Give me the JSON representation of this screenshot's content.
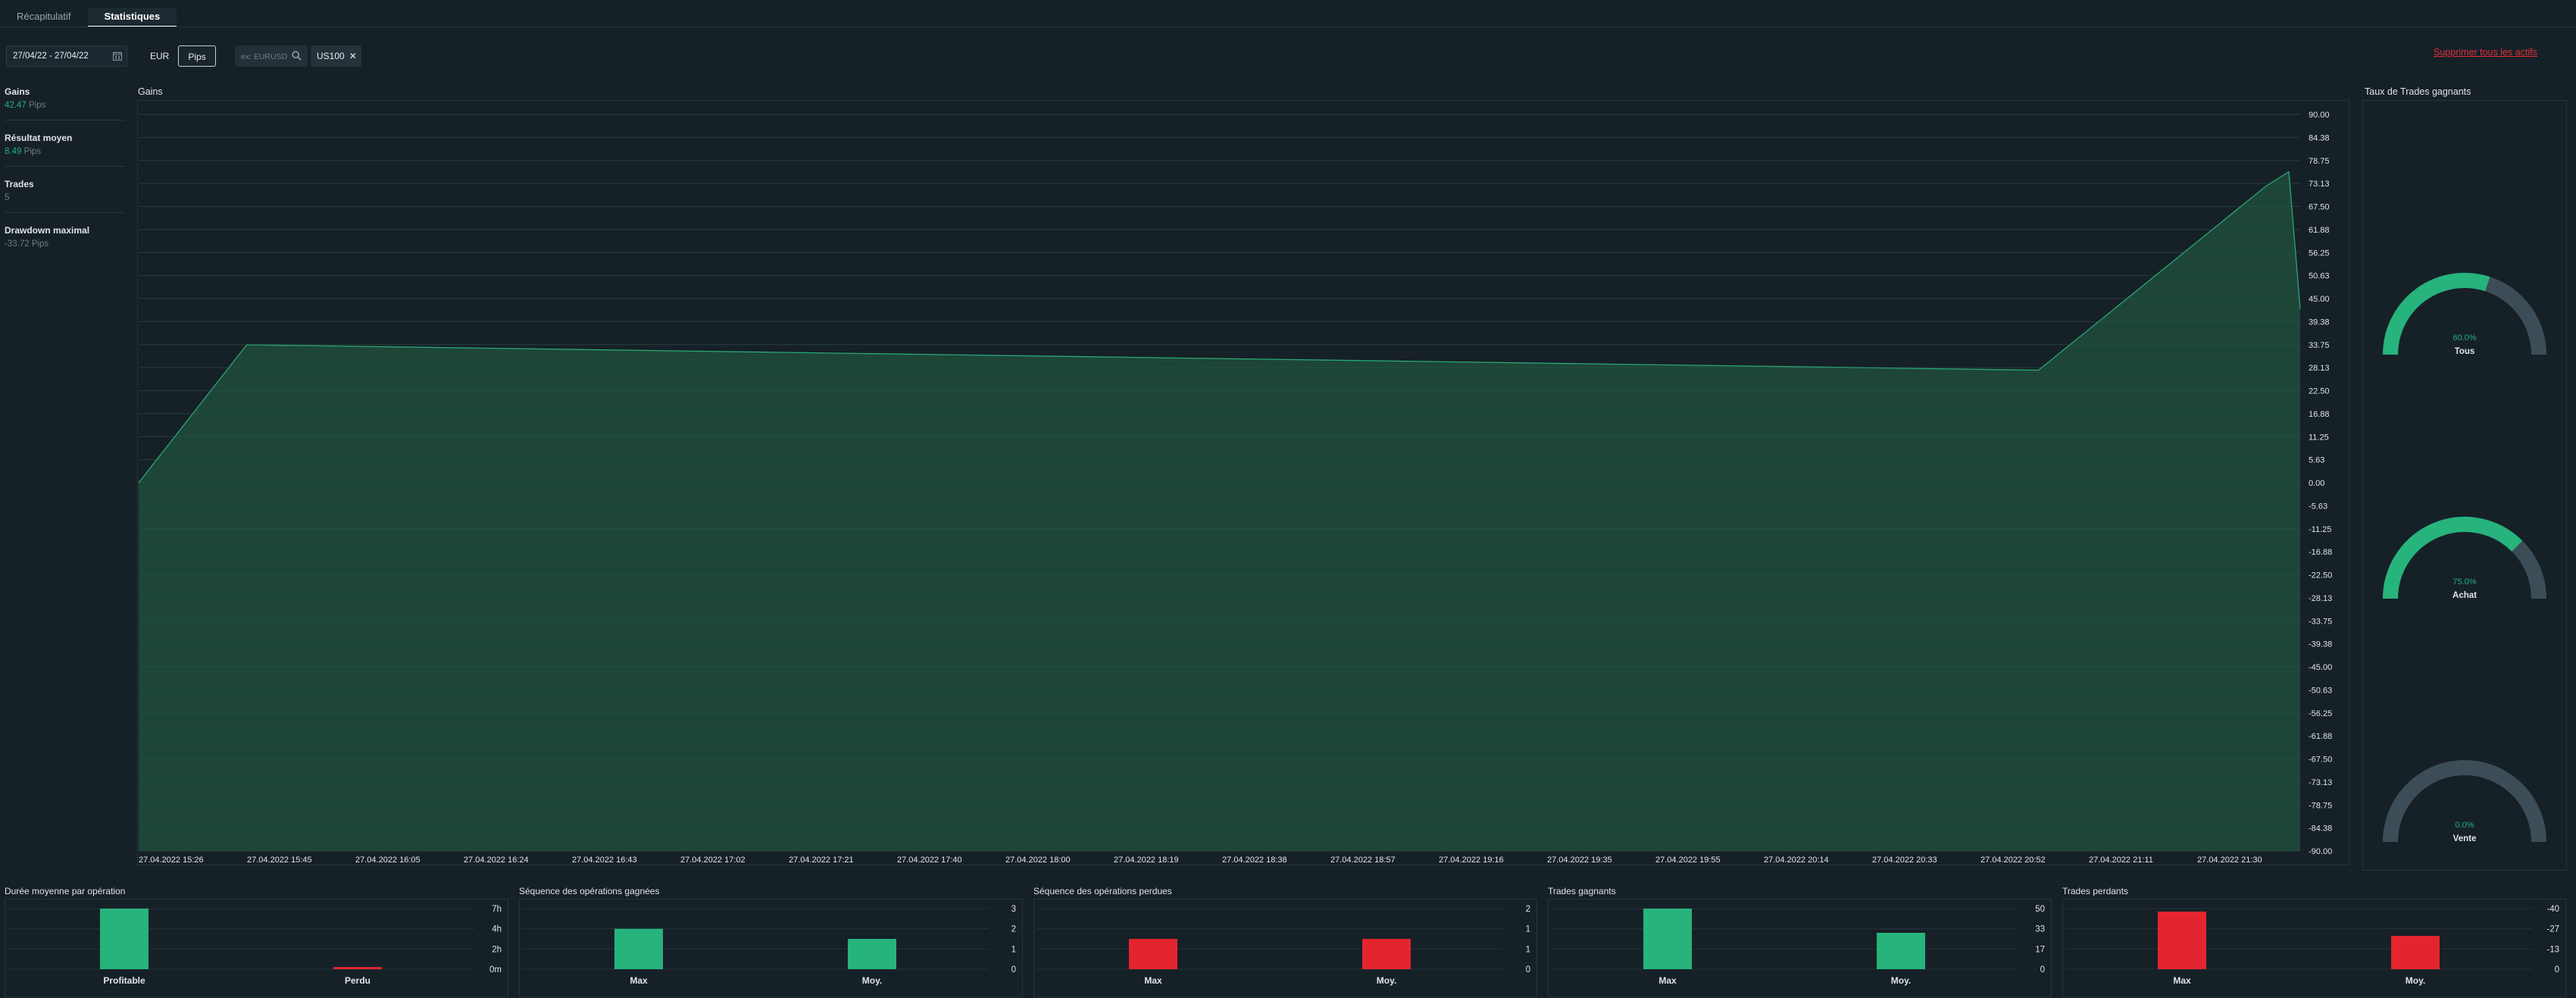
{
  "tabs": [
    {
      "label": "Récapitulatif",
      "active": false
    },
    {
      "label": "Statistiques",
      "active": true
    }
  ],
  "filters": {
    "date_range": "27/04/22 - 27/04/22",
    "currency_options": [
      "EUR",
      "Pips"
    ],
    "currency_selected": "Pips",
    "search_placeholder": "ex: EURUSD",
    "selected_asset": "US100",
    "remove_all_label": "Supprimer tous les actifs"
  },
  "stats": [
    {
      "label": "Gains",
      "value": "42.47",
      "unit": "Pips",
      "tone": "pos"
    },
    {
      "label": "Résultat moyen",
      "value": "8.49",
      "unit": "Pips",
      "tone": "pos"
    },
    {
      "label": "Trades",
      "value": "5",
      "unit": "",
      "tone": "neu"
    },
    {
      "label": "Drawdown maximal",
      "value": "-33.72",
      "unit": "Pips",
      "tone": "neu"
    }
  ],
  "colors": {
    "green": "#26b47c",
    "red": "#e42530",
    "gauge_track": "#3c4d57"
  },
  "main_chart": {
    "title": "Gains",
    "chart_data": {
      "type": "area",
      "title": "Gains",
      "ylim": [
        -90,
        90
      ],
      "y_ticks": [
        "90.00",
        "84.38",
        "78.75",
        "73.13",
        "67.50",
        "61.88",
        "56.25",
        "50.63",
        "45.00",
        "39.38",
        "33.75",
        "28.13",
        "22.50",
        "16.88",
        "11.25",
        "5.63",
        "0.00",
        "-5.63",
        "-11.25",
        "-16.88",
        "-22.50",
        "-28.13",
        "-33.75",
        "-39.38",
        "-45.00",
        "-50.63",
        "-56.25",
        "-61.88",
        "-67.50",
        "-73.13",
        "-78.75",
        "-84.38",
        "-90.00"
      ],
      "x_ticks": [
        "27.04.2022 15:26",
        "27.04.2022 15:45",
        "27.04.2022 16:05",
        "27.04.2022 16:24",
        "27.04.2022 16:43",
        "27.04.2022 17:02",
        "27.04.2022 17:21",
        "27.04.2022 17:40",
        "27.04.2022 18:00",
        "27.04.2022 18:19",
        "27.04.2022 18:38",
        "27.04.2022 18:57",
        "27.04.2022 19:16",
        "27.04.2022 19:35",
        "27.04.2022 19:55",
        "27.04.2022 20:14",
        "27.04.2022 20:33",
        "27.04.2022 20:52",
        "27.04.2022 21:11",
        "27.04.2022 21:30"
      ],
      "x_range": [
        "27.04.2022 15:26",
        "27.04.2022 21:46"
      ],
      "series": [
        {
          "values": [
            {
              "x": "27.04.2022 15:26",
              "y": 0
            },
            {
              "x": "27.04.2022 15:45",
              "y": 33.7
            },
            {
              "x": "27.04.2022 21:00",
              "y": 27.5
            },
            {
              "x": "27.04.2022 21:40",
              "y": 72.5
            },
            {
              "x": "27.04.2022 21:44",
              "y": 76.0
            },
            {
              "x": "27.04.2022 21:46",
              "y": 42.47
            }
          ]
        }
      ],
      "grid": true
    }
  },
  "winrate": {
    "title": "Taux de Trades gagnants",
    "gauges": [
      {
        "label": "Tous",
        "pct_text": "60.0%",
        "value": 60.0
      },
      {
        "label": "Achat",
        "pct_text": "75.0%",
        "value": 75.0
      },
      {
        "label": "Vente",
        "pct_text": "0.0%",
        "value": 0.0
      }
    ]
  },
  "mini_charts": [
    {
      "title": "Durée moyenne par opération",
      "type": "bar",
      "categories": [
        "Profitable",
        "Perdu"
      ],
      "values": [
        8.3,
        0.3
      ],
      "colors": [
        "green",
        "red"
      ],
      "ticks": [
        "7h",
        "4h",
        "2h",
        "0m"
      ],
      "ymax": 8.3
    },
    {
      "title": "Séquence des opérations gagnées",
      "type": "bar",
      "categories": [
        "Max",
        "Moy."
      ],
      "values": [
        2,
        1.5
      ],
      "colors": [
        "green",
        "green"
      ],
      "ticks": [
        "3",
        "2",
        "1",
        "0"
      ],
      "ymax": 3
    },
    {
      "title": "Séquence des opérations perdues",
      "type": "bar",
      "categories": [
        "Max",
        "Moy."
      ],
      "values": [
        1,
        1
      ],
      "colors": [
        "red",
        "red"
      ],
      "ticks": [
        "2",
        "1",
        "1",
        "0"
      ],
      "ymax": 2
    },
    {
      "title": "Trades gagnants",
      "type": "bar",
      "categories": [
        "Max",
        "Moy."
      ],
      "values": [
        50,
        30
      ],
      "colors": [
        "green",
        "green"
      ],
      "ticks": [
        "50",
        "33",
        "17",
        "0"
      ],
      "ymax": 50
    },
    {
      "title": "Trades perdants",
      "type": "bar",
      "categories": [
        "Max",
        "Moy."
      ],
      "values": [
        -38,
        -22
      ],
      "colors": [
        "red",
        "red"
      ],
      "ticks": [
        "-40",
        "-27",
        "-13",
        "0"
      ],
      "ymax": 40
    }
  ]
}
